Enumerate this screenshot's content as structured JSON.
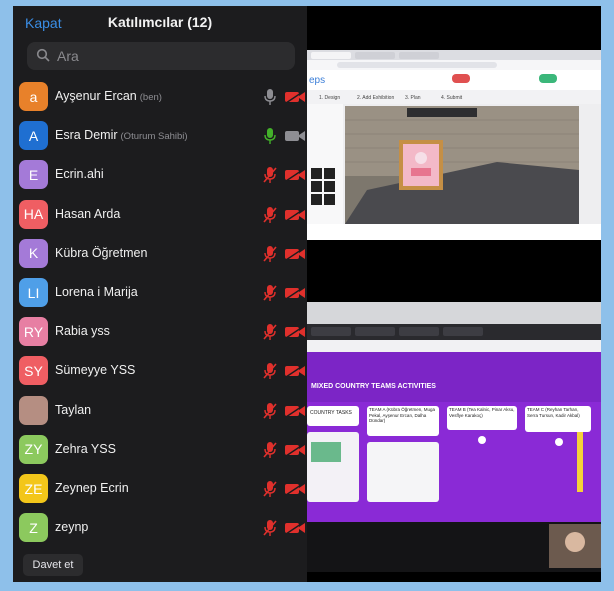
{
  "header": {
    "close_label": "Kapat",
    "title": "Katılımcılar (12)"
  },
  "search": {
    "placeholder": "Ara"
  },
  "participants": [
    {
      "initial": "a",
      "name": "Ayşenur Ercan",
      "role": "(ben)",
      "color": "#e8812a",
      "mic": "on",
      "mic_color": "#8e8e93"
    },
    {
      "initial": "A",
      "name": "Esra Demir",
      "role": "(Oturum Sahibi)",
      "color": "#1f6fd1",
      "mic": "on",
      "mic_color": "#43b02a"
    },
    {
      "initial": "E",
      "name": "Ecrin.ahi",
      "role": "",
      "color": "#a47ad8",
      "mic": "muted",
      "mic_color": "#e0302c"
    },
    {
      "initial": "HA",
      "name": "Hasan Arda",
      "role": "",
      "color": "#ef5e63",
      "mic": "muted",
      "mic_color": "#e0302c"
    },
    {
      "initial": "K",
      "name": "Kübra Öğretmen",
      "role": "",
      "color": "#a47ad8",
      "mic": "muted",
      "mic_color": "#e0302c"
    },
    {
      "initial": "LI",
      "name": "Lorena i Marija",
      "role": "",
      "color": "#4f9fe8",
      "mic": "muted",
      "mic_color": "#e0302c"
    },
    {
      "initial": "RY",
      "name": "Rabia yss",
      "role": "",
      "color": "#e77fa3",
      "mic": "muted",
      "mic_color": "#e0302c"
    },
    {
      "initial": "SY",
      "name": "Sümeyye YSS",
      "role": "",
      "color": "#ef5e63",
      "mic": "muted",
      "mic_color": "#e0302c"
    },
    {
      "initial": "",
      "name": "Taylan",
      "role": "",
      "color": "#b58e82",
      "mic": "muted",
      "mic_color": "#e0302c"
    },
    {
      "initial": "ZY",
      "name": "Zehra YSS",
      "role": "",
      "color": "#8cc95e",
      "mic": "muted",
      "mic_color": "#e0302c"
    },
    {
      "initial": "ZE",
      "name": "Zeynep Ecrin",
      "role": "",
      "color": "#f3c61a",
      "mic": "muted",
      "mic_color": "#e0302c"
    },
    {
      "initial": "Z",
      "name": "zeynp",
      "role": "",
      "color": "#8cc95e",
      "mic": "muted",
      "mic_color": "#e0302c"
    }
  ],
  "footer": {
    "invite_label": "Davet et"
  },
  "shared_screen_top": {
    "tabs": [
      "1. Design",
      "2. Add Exhibition",
      "3. Plan",
      "4. Submit"
    ],
    "brand": "eps"
  },
  "shared_screen_bottom": {
    "board_title": "MIXED COUNTRY TEAMS ACTIVITIES",
    "cards": [
      "COUNTRY TASKS",
      "TEAM A (Kübra Öğretmen, Muga Pekal, Ayşenur Ercan, Dalha Dündar)",
      "TEAM B (Tea Kalnic, Pinar Aksu, Vesflye Karakoç)",
      "TEAM C (Reyhan Tarhan, Serra Tursun, Kadir Akbal)"
    ]
  },
  "colors": {
    "panel_bg": "#1c1c1e",
    "accent": "#3a8ee6",
    "frame": "#8ec0ea",
    "muted_red": "#e0302c",
    "padlet_purple": "#8a2ad6"
  }
}
